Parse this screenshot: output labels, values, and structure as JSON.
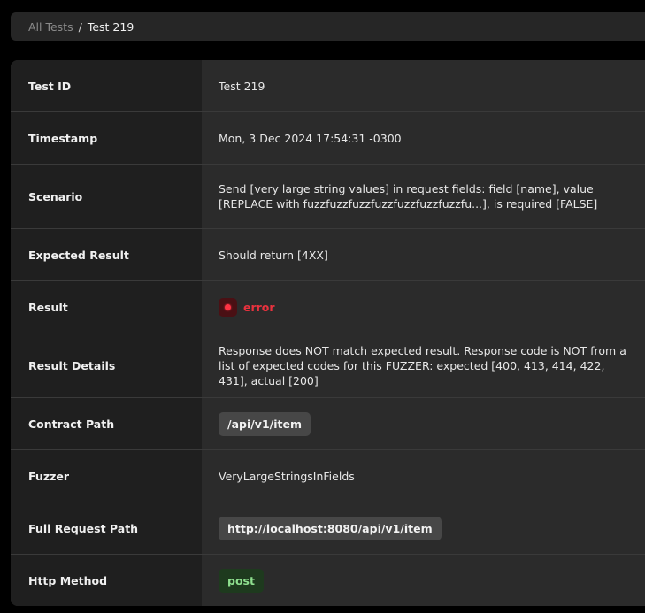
{
  "breadcrumb": {
    "root": "All Tests",
    "separator": "/",
    "current": "Test 219"
  },
  "details": {
    "test_id": {
      "label": "Test ID",
      "value": "Test 219"
    },
    "timestamp": {
      "label": "Timestamp",
      "value": "Mon, 3 Dec 2024 17:54:31 -0300"
    },
    "scenario": {
      "label": "Scenario",
      "value": "Send [very large string values] in request fields: field [name], value [REPLACE with fuzzfuzzfuzzfuzzfuzzfuzzfuzzfu...], is required [FALSE]"
    },
    "expected_result": {
      "label": "Expected Result",
      "value": "Should return [4XX]"
    },
    "result": {
      "label": "Result",
      "value": "error",
      "status_color": "#e8323e",
      "icon": "error-dot-icon"
    },
    "result_details": {
      "label": "Result Details",
      "value": "Response does NOT match expected result. Response code is NOT from a list of expected codes for this FUZZER: expected [400, 413, 414, 422, 431], actual [200]"
    },
    "contract_path": {
      "label": "Contract Path",
      "value": "/api/v1/item"
    },
    "fuzzer": {
      "label": "Fuzzer",
      "value": "VeryLargeStringsInFields"
    },
    "full_request_path": {
      "label": "Full Request Path",
      "value": "http://localhost:8080/api/v1/item"
    },
    "http_method": {
      "label": "Http Method",
      "value": "post",
      "badge_color": "#8fe08f"
    }
  }
}
